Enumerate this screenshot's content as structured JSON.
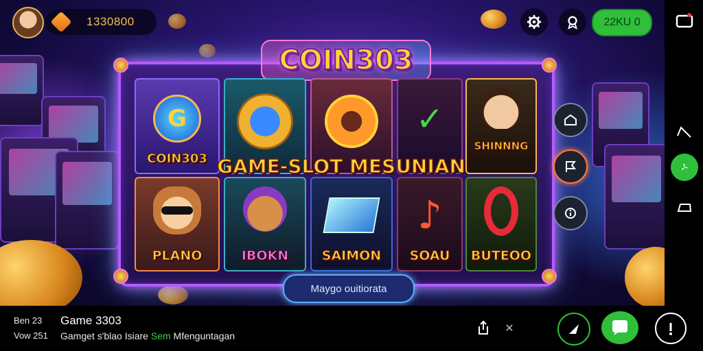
{
  "header": {
    "balance": "1330800",
    "credit": "22KU 0"
  },
  "game": {
    "logo": "COIN303",
    "banner": "GAME-SLOT MESUNIAN",
    "tiles_top": [
      "COIN303",
      "",
      "",
      "",
      "SHINNNG"
    ],
    "tiles_bottom": [
      "PLANO",
      "IBOKN",
      "SAIMON",
      "SOAU",
      "BUTEOO"
    ],
    "spin_label": "Maygo ouitiorata"
  },
  "footer": {
    "line1": "Ben 23",
    "line2": "Vow 251",
    "title": "Game 3303",
    "sub_prefix": "Gamget s'blao Isiare",
    "sub_green": "Sem",
    "sub_suffix": "Mfenguntagan"
  },
  "icons": {
    "gear": "gear-icon",
    "badge": "badge-icon",
    "screen": "screen-icon",
    "up": "chevron-up-icon",
    "flag": "flag-icon",
    "help": "help-icon"
  },
  "colors": {
    "accent_green": "#2fbf3a",
    "frame": "#b35cff",
    "gold_text": "#ffd23a"
  }
}
